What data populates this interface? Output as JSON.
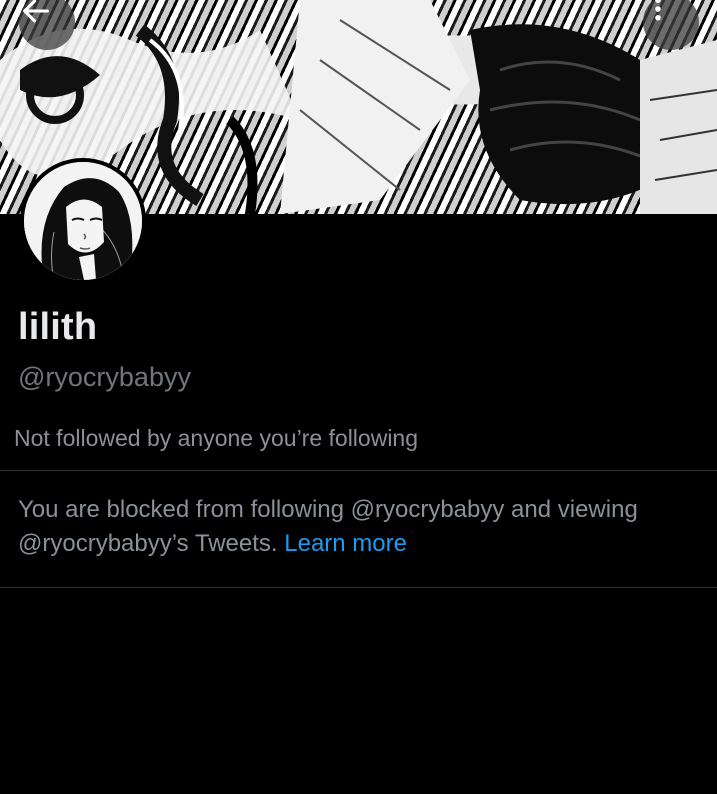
{
  "header": {
    "back_icon": "arrow-left-icon",
    "more_icon": "more-vertical-icon"
  },
  "profile": {
    "display_name": "lilith",
    "handle": "@ryocrybabyy",
    "followed_note": "Not followed by anyone you’re following"
  },
  "blocked_notice": {
    "text": "You are blocked from following @ryocrybabyy and viewing @ryocrybabyy’s Tweets.",
    "link_label": "Learn more"
  },
  "colors": {
    "background": "#000000",
    "primary_text": "#e7e9ea",
    "secondary_text": "#71767b",
    "link": "#1d9bf0",
    "divider": "#2f3336"
  }
}
